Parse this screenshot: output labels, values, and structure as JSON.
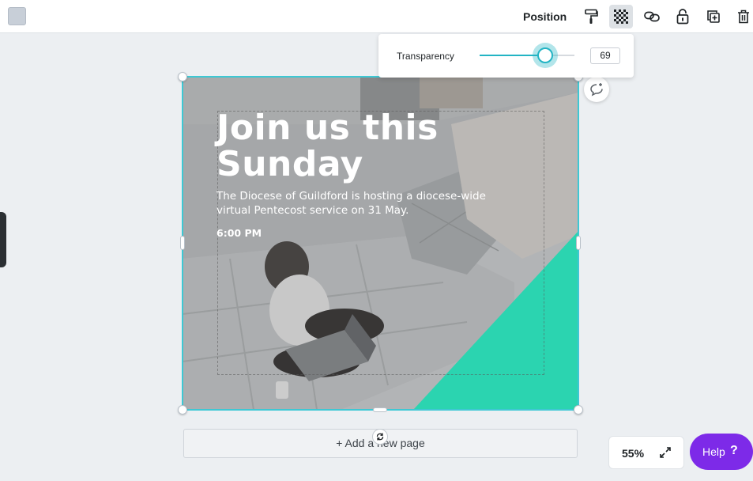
{
  "toolbar": {
    "position_label": "Position",
    "icons": [
      "paint-roller-icon",
      "transparency-icon",
      "link-icon",
      "lock-icon",
      "duplicate-icon",
      "trash-icon"
    ]
  },
  "transparency": {
    "label": "Transparency",
    "value": "69",
    "level": 0.69
  },
  "design": {
    "headline": "Join us this Sunday",
    "body": "The Diocese of Guildford is hosting a diocese-wide virtual Pentecost service on 31 May.",
    "time": "6:00 PM",
    "accent_color": "#2bd4b0"
  },
  "add_page_label": "+ Add a new page",
  "zoom": {
    "value": "55%"
  },
  "help": {
    "label": "Help",
    "icon": "?"
  },
  "colors": {
    "selection": "#3ec8d4",
    "slider_accent": "#23b4c4",
    "help_button": "#7d2ae8",
    "canvas_bg": "#eceff2"
  }
}
